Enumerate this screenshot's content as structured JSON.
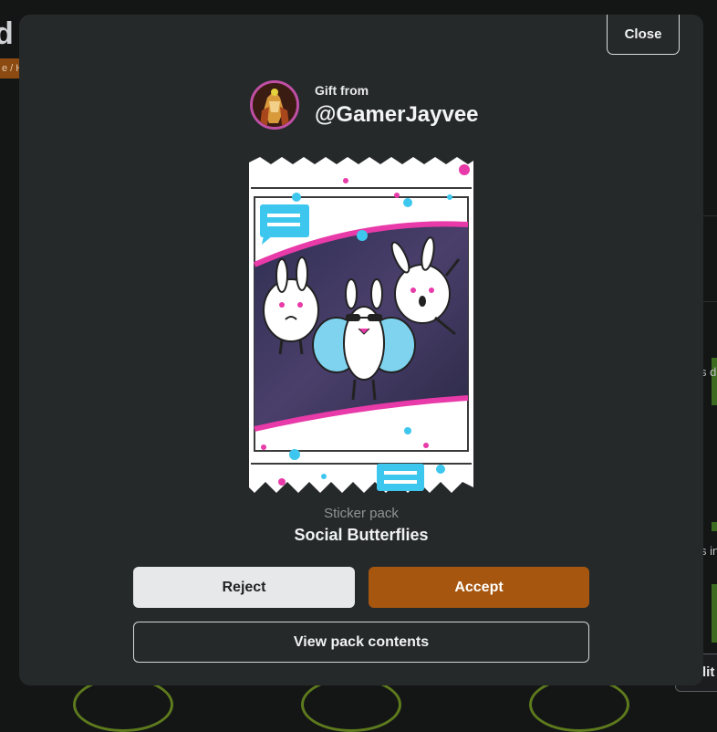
{
  "background": {
    "title_fragment": "d",
    "crumb_fragment": "e / H",
    "right_fragments": [
      "s d",
      "s in"
    ],
    "edit_button_fragment": "dit"
  },
  "modal": {
    "close_label": "Close",
    "gift_from_label": "Gift from",
    "gift_username": "@GamerJayvee",
    "pack_type": "Sticker pack",
    "pack_name": "Social Butterflies",
    "reject_label": "Reject",
    "accept_label": "Accept",
    "view_contents_label": "View pack contents"
  },
  "colors": {
    "modal_bg": "#26292a",
    "accept": "#a6560f",
    "reject": "#e6e8e9",
    "pack_pink": "#e83aa8",
    "pack_cyan": "#3ec7ee"
  },
  "icons": {
    "avatar": "user-avatar",
    "pack_art": "sticker-pack-illustration"
  }
}
